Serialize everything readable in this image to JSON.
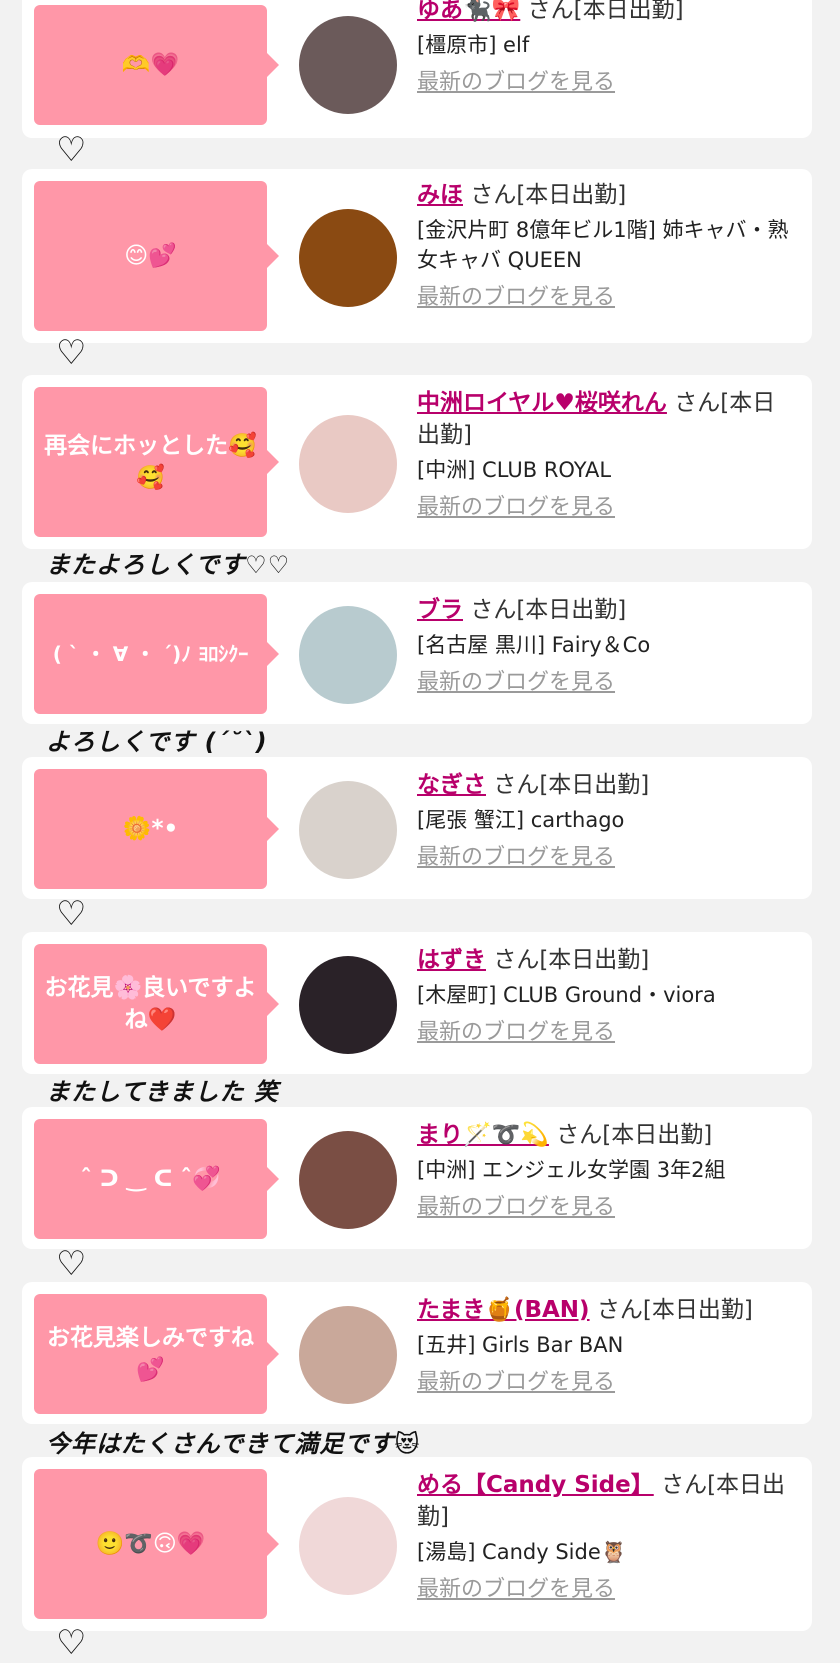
{
  "common": {
    "san_suffix": "さん",
    "today_label": "[本日出勤]",
    "blog_link": "最新のブログを見る"
  },
  "items": [
    {
      "message": "🫶💗",
      "name": "ゆあ🐈‍⬛🎀",
      "suffix": "さん[本日出勤]",
      "shop": "[橿原市] elf",
      "blog": "最新のブログを見る",
      "note": "♡",
      "avatar_color": "#6b5a5a"
    },
    {
      "message": "😊💕",
      "name": "みほ",
      "suffix": "さん[本日出勤]",
      "shop": "[金沢片町 8億年ビル1階] 姉キャバ・熟女キャバ QUEEN",
      "blog": "最新のブログを見る",
      "note": "♡",
      "avatar_color": "#8a4a12"
    },
    {
      "message": "再会にホッとした🥰🥰",
      "name": "中洲ロイヤル♥桜咲れん",
      "suffix": "さん[本日出勤]",
      "shop": "[中洲] CLUB ROYAL",
      "blog": "最新のブログを見る",
      "note": "またよろしくです♡♡",
      "avatar_color": "#e9c9c4"
    },
    {
      "message": "( ˋ ・ ∀ ・ ´)ﾉ ﾖﾛｼｸｰ",
      "name": "ブラ",
      "suffix": "さん[本日出勤]",
      "shop": "[名古屋 黒川] Fairy＆Co",
      "blog": "最新のブログを見る",
      "note": "よろしくです (´˘`)",
      "avatar_color": "#b8cbcf"
    },
    {
      "message": "🌼*•",
      "name": "なぎさ",
      "suffix": "さん[本日出勤]",
      "shop": "[尾張 蟹江] carthago",
      "blog": "最新のブログを見る",
      "note": "♡",
      "avatar_color": "#d9d2cc"
    },
    {
      "message": "お花見🌸良いですよね❤️",
      "name": "はずき",
      "suffix": "さん[本日出勤]",
      "shop": "[木屋町] CLUB Ground・viora",
      "blog": "最新のブログを見る",
      "note": "またしてきました 笑",
      "avatar_color": "#2a2228"
    },
    {
      "message": "ˆ ᑐ ‿ ᑕ ˆ💞",
      "name": "まり🪄➰💫",
      "suffix": "さん[本日出勤]",
      "shop": "[中洲] エンジェル女学園 3年2組",
      "blog": "最新のブログを見る",
      "note": "♡",
      "avatar_color": "#7a4e44"
    },
    {
      "message": "お花見楽しみですね💕",
      "name": "たまき🍯(BAN)",
      "suffix": "さん[本日出勤]",
      "shop": "[五井] Girls Bar BAN",
      "blog": "最新のブログを見る",
      "note": "今年はたくさんできて満足です😻",
      "avatar_color": "#c9a89a"
    },
    {
      "message": "🙂➰🙃💗",
      "name": "める【Candy Side】",
      "suffix": "さん[本日出勤]",
      "shop": "[湯島] Candy Side🦉",
      "blog": "最新のブログを見る",
      "note": "♡",
      "avatar_color": "#f0d8d8"
    }
  ]
}
